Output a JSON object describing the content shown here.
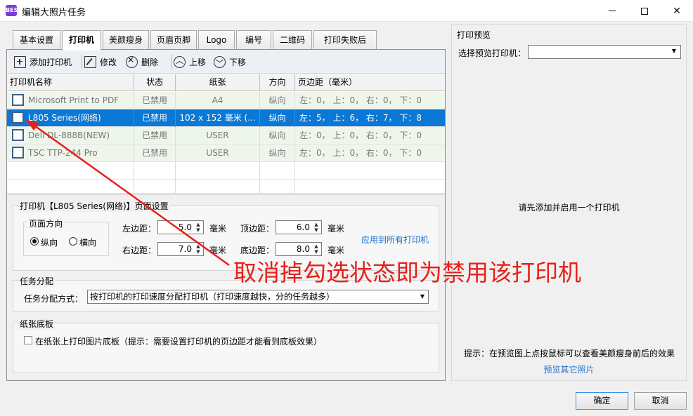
{
  "window": {
    "icon_text": "BEST",
    "title": "编辑大照片任务",
    "minimize": "—",
    "maximize": "□",
    "close": "✕"
  },
  "tabs": [
    {
      "label": "基本设置",
      "active": false
    },
    {
      "label": "打印机",
      "active": true
    },
    {
      "label": "美颜瘦身",
      "active": false
    },
    {
      "label": "页眉页脚",
      "active": false
    },
    {
      "label": "Logo",
      "active": false
    },
    {
      "label": "编号",
      "active": false
    },
    {
      "label": "二维码",
      "active": false
    },
    {
      "label": "打印失败后",
      "active": false
    }
  ],
  "toolbar": {
    "add_label": "添加打印机",
    "add_icon": "plus-icon",
    "edit_label": "修改",
    "edit_icon": "edit-icon",
    "delete_label": "删除",
    "delete_icon": "delete-circle-icon",
    "up_label": "上移",
    "up_icon": "arrow-up-circle-icon",
    "down_label": "下移",
    "down_icon": "arrow-down-circle-icon"
  },
  "grid": {
    "columns": [
      "打印机名称",
      "状态",
      "纸张",
      "方向",
      "页边距（毫米）"
    ],
    "rows": [
      {
        "name": "Microsoft Print to PDF",
        "status": "已禁用",
        "paper": "A4",
        "orientation": "纵向",
        "margins": "左：0，  上：0，  右：0，  下：0",
        "checked": false,
        "selected": false
      },
      {
        "name": "L805 Series(网络)",
        "status": "已禁用",
        "paper": "102 x 152 毫米 (...",
        "orientation": "纵向",
        "margins": "左：5，  上：6，  右：7，  下：8",
        "checked": false,
        "selected": true
      },
      {
        "name": "Deli DL-888B(NEW)",
        "status": "已禁用",
        "paper": "USER",
        "orientation": "纵向",
        "margins": "左：0，  上：0，  右：0，  下：0",
        "checked": false,
        "selected": false
      },
      {
        "name": "TSC TTP-244 Pro",
        "status": "已禁用",
        "paper": "USER",
        "orientation": "纵向",
        "margins": "左：0，  上：0，  右：0，  下：0",
        "checked": false,
        "selected": false
      }
    ]
  },
  "page_settings": {
    "title": "打印机【L805 Series(网络)】页面设置",
    "orientation_title": "页面方向",
    "portrait": "纵向",
    "landscape": "横向",
    "left_label": "左边距：",
    "left_value": "5.0",
    "right_label": "右边距：",
    "right_value": "7.0",
    "top_label": "顶边距：",
    "top_value": "6.0",
    "bottom_label": "底边距：",
    "bottom_value": "8.0",
    "unit": "毫米",
    "apply_all": "应用到所有打印机"
  },
  "task_dist": {
    "title": "任务分配",
    "method_label": "任务分配方式：",
    "method_value": "按打印机的打印速度分配打印机（打印速度越快，分的任务越多）"
  },
  "paper_bg": {
    "title": "纸张底板",
    "checkbox_label": "在纸张上打印图片底板（提示：需要设置打印机的页边距才能看到底板效果）"
  },
  "preview": {
    "title": "打印预览",
    "select_label": "选择预览打印机：",
    "select_value": "",
    "empty_msg": "请先添加并启用一个打印机",
    "hint": "提示：在预览图上点按鼠标可以查看美颜瘦身前后的效果",
    "other_link": "预览其它照片"
  },
  "footer": {
    "ok": "确定",
    "cancel": "取消"
  },
  "annotation": {
    "text": "取消掉勾选状态即为禁用该打印机",
    "color": "#e8201a"
  }
}
